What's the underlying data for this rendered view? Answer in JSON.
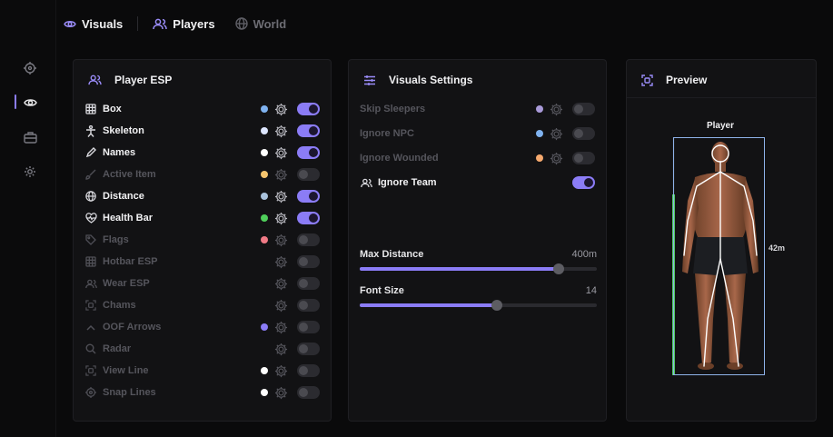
{
  "tabs": [
    {
      "label": "Visuals",
      "icon": "eye-icon",
      "active": true
    },
    {
      "label": "Players",
      "icon": "users-icon",
      "active": true
    },
    {
      "label": "World",
      "icon": "globe-icon",
      "active": false
    }
  ],
  "sidebar": {
    "items": [
      {
        "icon": "crosshair-icon"
      },
      {
        "icon": "eye-icon",
        "active": true
      },
      {
        "icon": "briefcase-icon"
      },
      {
        "icon": "gear-icon"
      }
    ]
  },
  "player_esp": {
    "title": "Player ESP",
    "items": [
      {
        "label": "Box",
        "icon": "grid-icon",
        "dot": "#7fb2f0",
        "enabled": true
      },
      {
        "label": "Skeleton",
        "icon": "person-icon",
        "dot": "#dde6ff",
        "enabled": true
      },
      {
        "label": "Names",
        "icon": "pencil-icon",
        "dot": "#ffffff",
        "enabled": true
      },
      {
        "label": "Active Item",
        "icon": "brush-icon",
        "dot": "#f6c56e",
        "enabled": false
      },
      {
        "label": "Distance",
        "icon": "globe-icon",
        "dot": "#a9c2dc",
        "enabled": true
      },
      {
        "label": "Health Bar",
        "icon": "heart-pulse-icon",
        "dot": "#4fcf5b",
        "enabled": true
      },
      {
        "label": "Flags",
        "icon": "tag-icon",
        "dot": "#f07a86",
        "enabled": false
      },
      {
        "label": "Hotbar ESP",
        "icon": "grid-icon",
        "dot": "",
        "enabled": false
      },
      {
        "label": "Wear ESP",
        "icon": "users-icon",
        "dot": "",
        "enabled": false
      },
      {
        "label": "Chams",
        "icon": "scan-icon",
        "dot": "",
        "enabled": false
      },
      {
        "label": "OOF Arrows",
        "icon": "chevron-up-icon",
        "dot": "#8b7cf6",
        "enabled": false
      },
      {
        "label": "Radar",
        "icon": "search-icon",
        "dot": "",
        "enabled": false
      },
      {
        "label": "View Line",
        "icon": "scan-icon",
        "dot": "#ffffff",
        "enabled": false
      },
      {
        "label": "Snap Lines",
        "icon": "target-icon",
        "dot": "#ffffff",
        "enabled": false
      }
    ]
  },
  "visuals_settings": {
    "title": "Visuals Settings",
    "items": [
      {
        "label": "Skip Sleepers",
        "icon": "",
        "dot": "#a99ad9",
        "enabled": false
      },
      {
        "label": "Ignore NPC",
        "icon": "",
        "dot": "#7fb2f0",
        "enabled": false
      },
      {
        "label": "Ignore Wounded",
        "icon": "",
        "dot": "#f6a96e",
        "enabled": false
      },
      {
        "label": "Ignore Team",
        "icon": "users-icon",
        "dot": "",
        "enabled": true
      }
    ],
    "sliders": [
      {
        "label": "Max Distance",
        "value": "400m",
        "fraction": 0.84
      },
      {
        "label": "Font Size",
        "value": "14",
        "fraction": 0.58
      }
    ]
  },
  "preview": {
    "title": "Preview",
    "player_name": "Player",
    "distance": "42m",
    "health_fraction": 0.76
  }
}
